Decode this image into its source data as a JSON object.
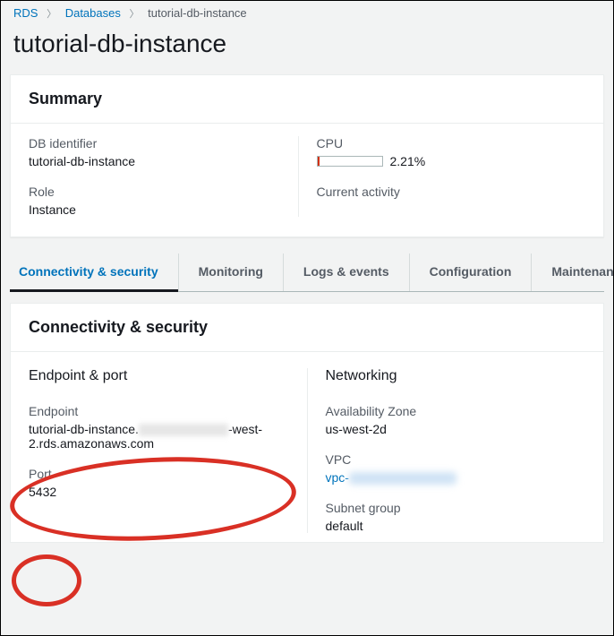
{
  "breadcrumb": {
    "root": "RDS",
    "second": "Databases",
    "current": "tutorial-db-instance"
  },
  "page_title": "tutorial-db-instance",
  "summary": {
    "heading": "Summary",
    "db_identifier_label": "DB identifier",
    "db_identifier_value": "tutorial-db-instance",
    "role_label": "Role",
    "role_value": "Instance",
    "cpu_label": "CPU",
    "cpu_value": "2.21%",
    "current_activity_label": "Current activity"
  },
  "tabs": {
    "connectivity": "Connectivity & security",
    "monitoring": "Monitoring",
    "logs": "Logs & events",
    "configuration": "Configuration",
    "maintenance": "Maintenanc"
  },
  "cs": {
    "heading": "Connectivity & security",
    "endpoint_port_heading": "Endpoint & port",
    "endpoint_label": "Endpoint",
    "endpoint_prefix": "tutorial-db-instance.",
    "endpoint_suffix": "-west-2.rds.amazonaws.com",
    "port_label": "Port",
    "port_value": "5432",
    "networking_heading": "Networking",
    "az_label": "Availability Zone",
    "az_value": "us-west-2d",
    "vpc_label": "VPC",
    "vpc_prefix": "vpc-",
    "subnet_label": "Subnet group",
    "subnet_value": "default"
  }
}
